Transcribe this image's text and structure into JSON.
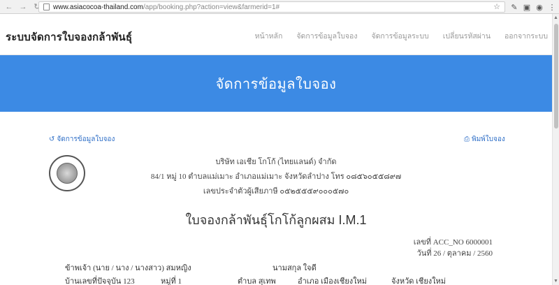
{
  "browser": {
    "url_domain": "www.asiacocoa-thailand.com",
    "url_path": "/app/booking.php?action=view&farmerid=1#"
  },
  "navbar": {
    "brand": "ระบบจัดการใบจองกล้าพันธุ์",
    "links": [
      "หน้าหลัก",
      "จัดการข้อมูลใบจอง",
      "จัดการข้อมูลระบบ",
      "เปลี่ยนรหัสผ่าน",
      "ออกจากระบบ"
    ]
  },
  "hero": {
    "title": "จัดการข้อมูลใบจอง"
  },
  "actions": {
    "manage_label": "จัดการข้อมูลใบจอง",
    "print_label": "พิมพ์ใบจอง"
  },
  "company": {
    "name": "บริษัท เอเชีย โกโก้ (ไทยแลนด์) จำกัด",
    "address": "84/1 หมู่ 10 ตำบลแม่เมาะ อำเภอแม่เมาะ จังหวัดลำปาง โทร ๐๘๕๖๐๕๕๘๙๗",
    "tax_id": "เลขประจำตัวผู้เสียภาษี ๐๕๒๕๕๕๙๐๐๐๕๗๐"
  },
  "document": {
    "title": "ใบจองกล้าพันธุ์โกโก้ลูกผสม I.M.1",
    "number": "เลขที่ ACC_NO 6000001",
    "date": "วันที่ 26 / ตุลาคม / 2560"
  },
  "form": {
    "title_line": "ข้าพเจ้า (นาย / นาง / นางสาว) สมหญิง",
    "surname": "นามสกุล ใจดี",
    "house_no": "บ้านเลขที่ปัจจุบัน 123",
    "moo": "หมู่ที่ 1",
    "tambon": "ตำบล สุเทพ",
    "amphoe": "อำเภอ เมืองเชียงใหม่",
    "province": "จังหวัด เชียงใหม่"
  },
  "icons": {
    "back": "back-arrow-icon",
    "forward": "forward-arrow-icon",
    "reload": "reload-icon",
    "refresh": "refresh-icon",
    "print": "print-icon"
  },
  "colors": {
    "hero": "#3c8ae4",
    "link": "#2f6fc7"
  }
}
